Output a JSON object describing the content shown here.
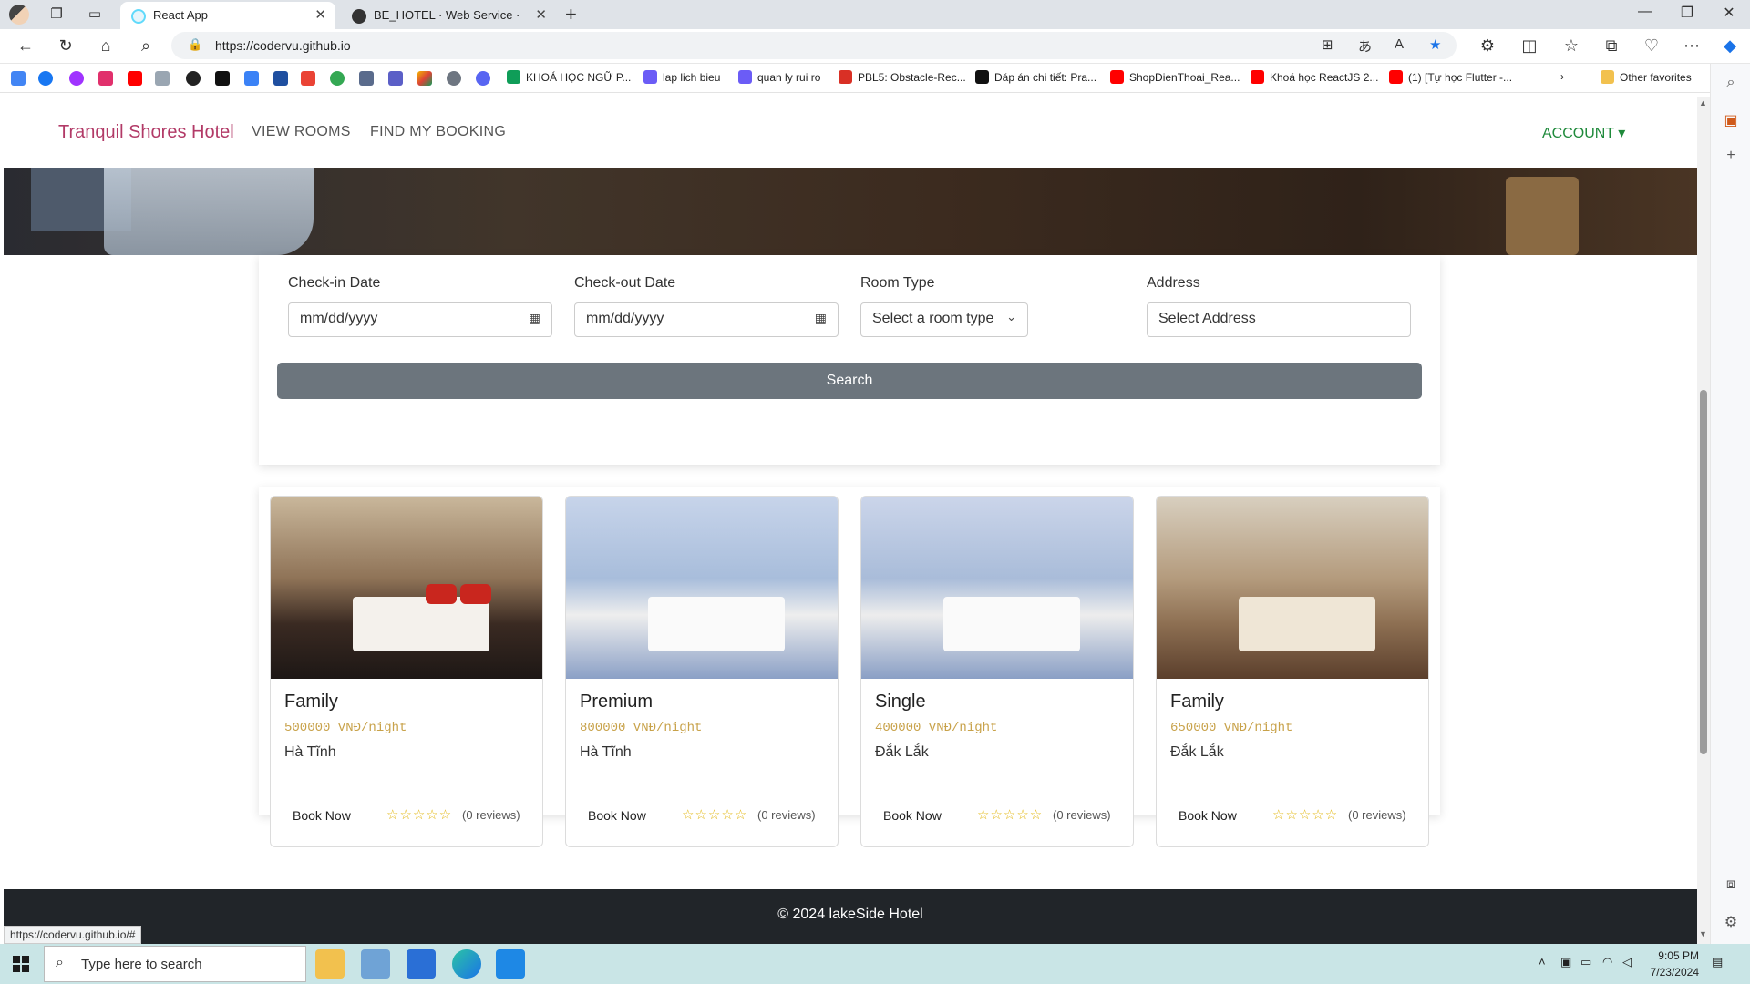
{
  "browser": {
    "tabs": [
      {
        "title": "React App",
        "active": true
      },
      {
        "title": "BE_HOTEL · Web Service · Rende",
        "active": false
      }
    ],
    "url": "https://codervu.github.io",
    "bookmarks": [
      "KHOÁ HỌC NGỮ P...",
      "lap lich bieu",
      "quan ly rui ro",
      "PBL5: Obstacle-Rec...",
      "Đáp án chi tiết: Pra...",
      "ShopDienThoai_Rea...",
      "Khoá học ReactJS 2...",
      "(1) [Tự học Flutter -..."
    ],
    "other_favorites": "Other favorites",
    "status_url": "https://codervu.github.io/#"
  },
  "site": {
    "brand": "Tranquil Shores Hotel",
    "nav": {
      "view_rooms": "VIEW ROOMS",
      "find_booking": "FIND MY BOOKING",
      "account": "ACCOUNT ▾"
    },
    "search": {
      "checkin_label": "Check-in Date",
      "checkin_placeholder": "mm/dd/yyyy",
      "checkout_label": "Check-out Date",
      "checkout_placeholder": "mm/dd/yyyy",
      "roomtype_label": "Room Type",
      "roomtype_value": "Select a room type",
      "address_label": "Address",
      "address_value": "Select Address",
      "button": "Search"
    },
    "rooms": [
      {
        "type": "Family",
        "price": "500000 VNĐ/night",
        "address": "Hà Tĩnh",
        "book": "Book Now",
        "stars": "☆☆☆☆☆",
        "reviews": "(0 reviews)"
      },
      {
        "type": "Premium",
        "price": "800000 VNĐ/night",
        "address": "Hà Tĩnh",
        "book": "Book Now",
        "stars": "☆☆☆☆☆",
        "reviews": "(0 reviews)"
      },
      {
        "type": "Single",
        "price": "400000 VNĐ/night",
        "address": "Đắk Lắk",
        "book": "Book Now",
        "stars": "☆☆☆☆☆",
        "reviews": "(0 reviews)"
      },
      {
        "type": "Family",
        "price": "650000 VNĐ/night",
        "address": "Đắk Lắk",
        "book": "Book Now",
        "stars": "☆☆☆☆☆",
        "reviews": "(0 reviews)"
      }
    ],
    "footer": "© 2024 lakeSide Hotel"
  },
  "taskbar": {
    "search_placeholder": "Type here to search",
    "time": "9:05 PM",
    "date": "7/23/2024"
  },
  "colors": {
    "brand": "#b23a67",
    "account": "#1f8a3b",
    "price": "#c8a24a",
    "search_button": "#6c757d",
    "footer": "#212529"
  }
}
